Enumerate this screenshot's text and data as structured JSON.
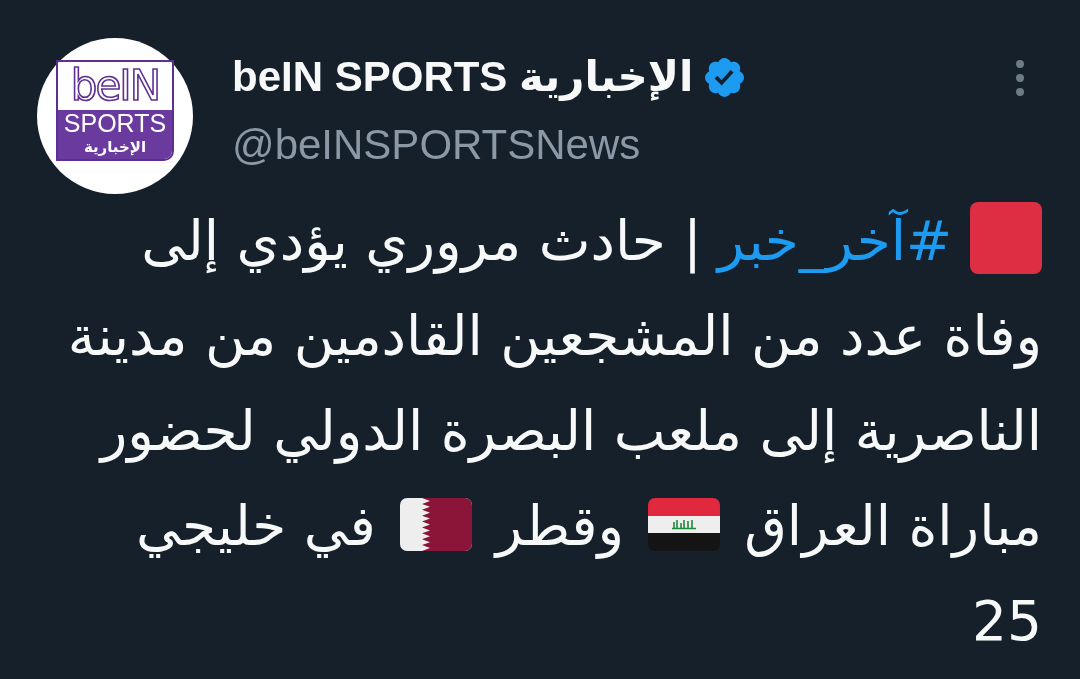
{
  "account": {
    "avatar": {
      "wordmark": "beIN",
      "lines": [
        "SPORTS",
        "الإخبارية"
      ]
    },
    "name": "beIN SPORTS الإخبارية",
    "verified": true,
    "handle": "@beINSPORTSNews"
  },
  "tweet": {
    "segments": [
      {
        "kind": "redsquare"
      },
      {
        "kind": "hashtag",
        "text": "#آخر_خبر"
      },
      {
        "kind": "text",
        "text": "| حادث مروري يؤدي إلى وفاة عدد من المشجعين القادمين من مدينة الناصرية إلى ملعب البصرة الدولي لحضور مباراة العراق"
      },
      {
        "kind": "iraqflag"
      },
      {
        "kind": "text",
        "text": "وقطر"
      },
      {
        "kind": "qatarflag"
      },
      {
        "kind": "text",
        "text": "في خليجي 25"
      }
    ]
  }
}
